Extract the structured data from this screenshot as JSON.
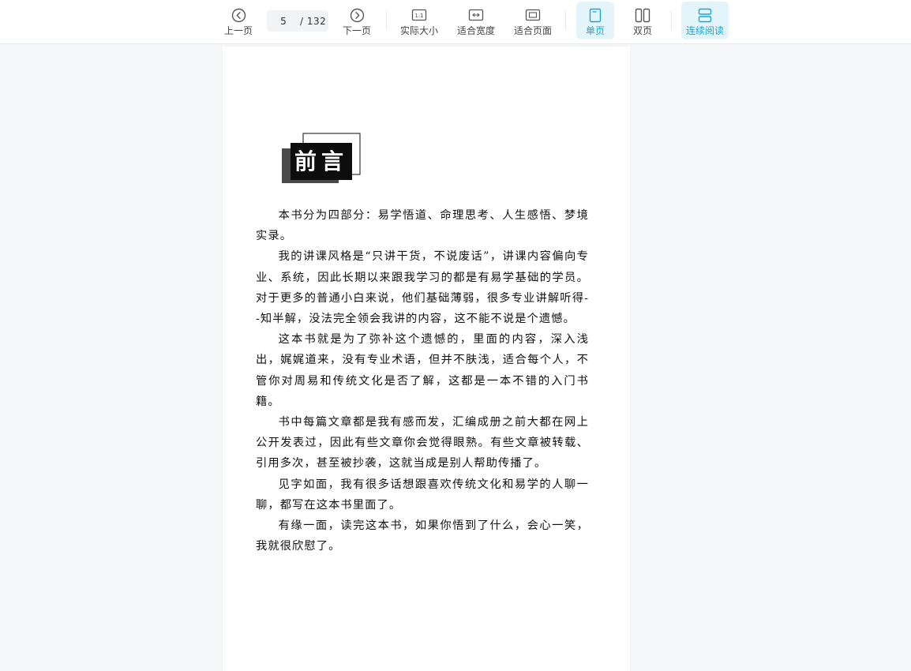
{
  "toolbar": {
    "prev_label": "上一页",
    "page_current": "5",
    "page_total": "/ 132",
    "next_label": "下一页",
    "actual_size_label": "实际大小",
    "fit_width_label": "适合宽度",
    "fit_page_label": "适合页面",
    "single_page_label": "单页",
    "double_page_label": "双页",
    "continuous_label": "连续阅读",
    "actual_size_icon_text": "1:1",
    "active_modes": [
      "单页",
      "连续阅读"
    ],
    "accent_color": "#1aa6d4"
  },
  "document": {
    "heading": "前言",
    "paragraphs": [
      "本书分为四部分：易学悟道、命理思考、人生感悟、梦境实录。",
      "我的讲课风格是“只讲干货，不说废话”，讲课内容偏向专业、系统，因此长期以来跟我学习的都是有易学基础的学员。对于更多的普通小白来说，他们基础薄弱，很多专业讲解听得--知半解，没法完全领会我讲的内容，这不能不说是个遗憾。",
      "这本书就是为了弥补这个遗憾的，里面的内容，深入浅出，娓娓道来，没有专业术语，但并不肤浅，适合每个人，不管你对周易和传统文化是否了解，这都是一本不错的入门书籍。",
      "书中每篇文章都是我有感而发，汇编成册之前大都在网上公开发表过，因此有些文章你会觉得眼熟。有些文章被转载、引用多次，甚至被抄袭，这就当成是别人帮助传播了。",
      "见字如面，我有很多话想跟喜欢传统文化和易学的人聊一聊，都写在这本书里面了。",
      "有缘一面，读完这本书，如果你悟到了什么，会心一笑，我就很欣慰了。"
    ]
  }
}
